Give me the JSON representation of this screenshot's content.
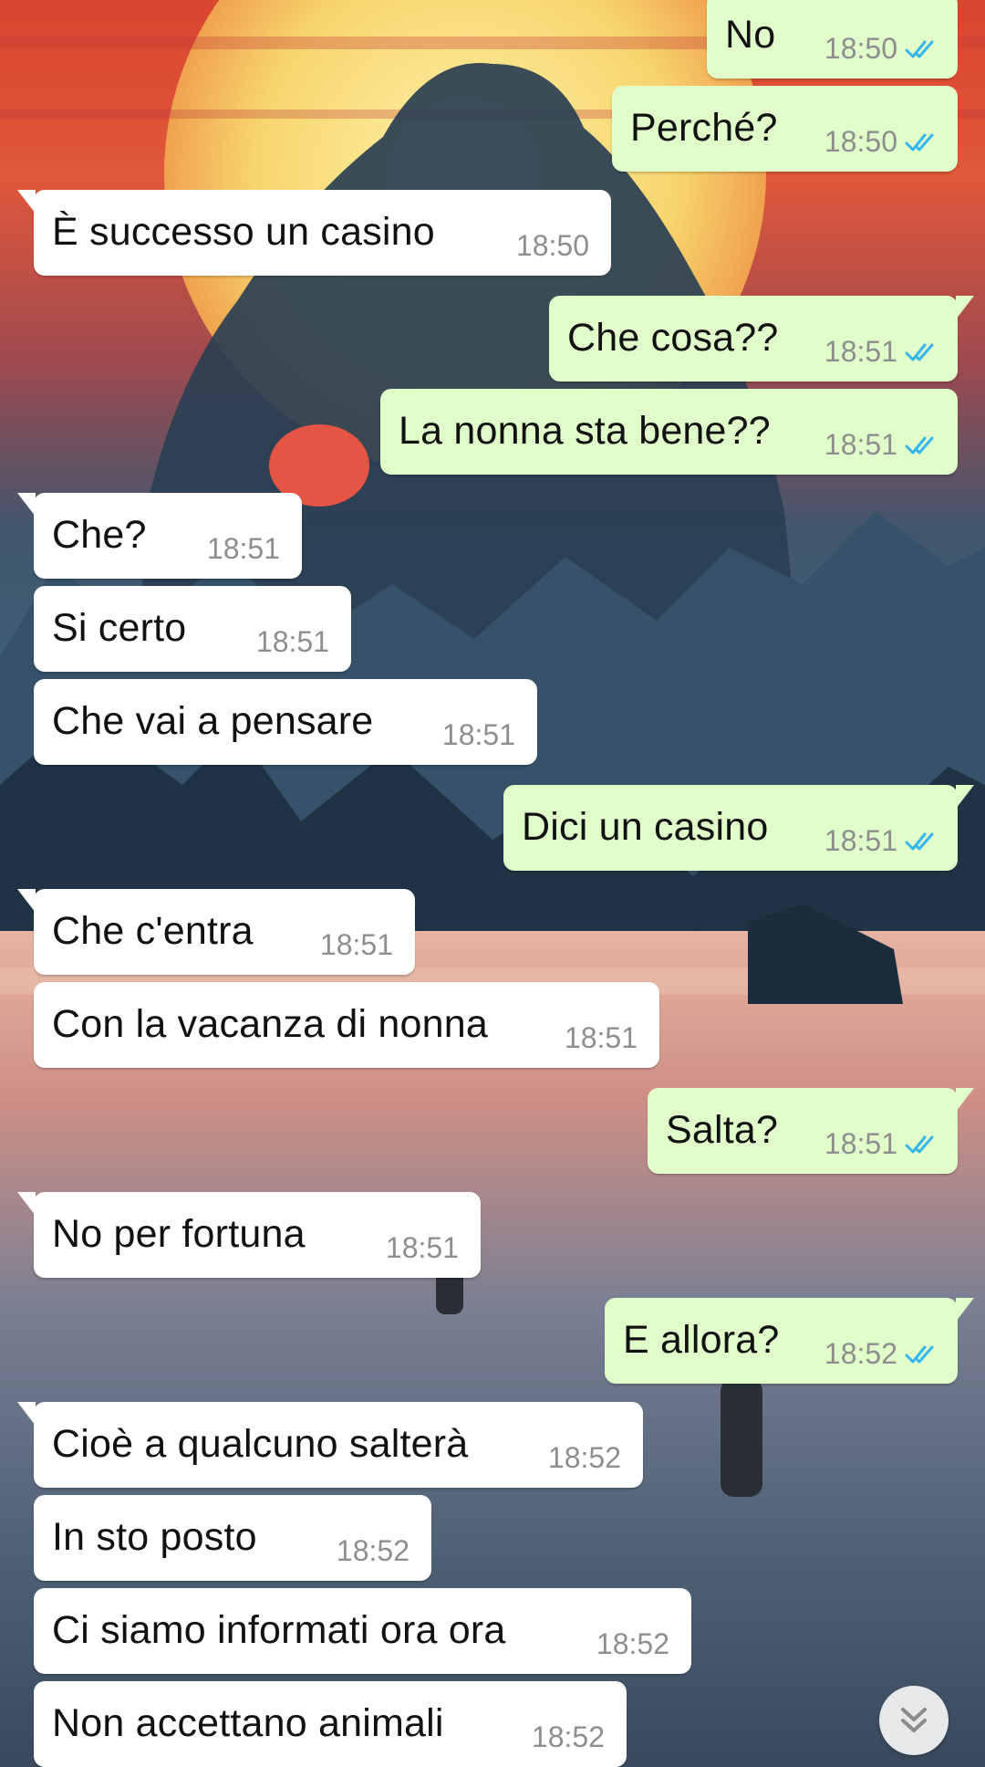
{
  "colors": {
    "incoming_bubble": "#ffffff",
    "outgoing_bubble": "#e1fdc9",
    "read_ticks": "#34b7f1",
    "timestamp": "#8e8e8e"
  },
  "messages": [
    {
      "dir": "out",
      "text": "No",
      "time": "18:50",
      "read": true
    },
    {
      "dir": "out",
      "text": "Perché?",
      "time": "18:50",
      "read": true
    },
    {
      "dir": "in",
      "text": "È successo un casino",
      "time": "18:50"
    },
    {
      "dir": "out",
      "text": "Che cosa??",
      "time": "18:51",
      "read": true
    },
    {
      "dir": "out",
      "text": "La nonna sta bene??",
      "time": "18:51",
      "read": true
    },
    {
      "dir": "in",
      "text": "Che?",
      "time": "18:51"
    },
    {
      "dir": "in",
      "text": "Si certo",
      "time": "18:51"
    },
    {
      "dir": "in",
      "text": "Che vai a pensare",
      "time": "18:51"
    },
    {
      "dir": "out",
      "text": "Dici un casino",
      "time": "18:51",
      "read": true
    },
    {
      "dir": "in",
      "text": "Che c'entra",
      "time": "18:51"
    },
    {
      "dir": "in",
      "text": "Con la vacanza di nonna",
      "time": "18:51"
    },
    {
      "dir": "out",
      "text": "Salta?",
      "time": "18:51",
      "read": true
    },
    {
      "dir": "in",
      "text": "No per fortuna",
      "time": "18:51"
    },
    {
      "dir": "out",
      "text": "E allora?",
      "time": "18:52",
      "read": true
    },
    {
      "dir": "in",
      "text": "Cioè a qualcuno salterà",
      "time": "18:52"
    },
    {
      "dir": "in",
      "text": "In sto posto",
      "time": "18:52"
    },
    {
      "dir": "in",
      "text": "Ci siamo informati ora ora",
      "time": "18:52"
    },
    {
      "dir": "in",
      "text": "Non accettano animali",
      "time": "18:52"
    }
  ],
  "scroll_button": {
    "icon": "double-chevron-down-icon"
  }
}
